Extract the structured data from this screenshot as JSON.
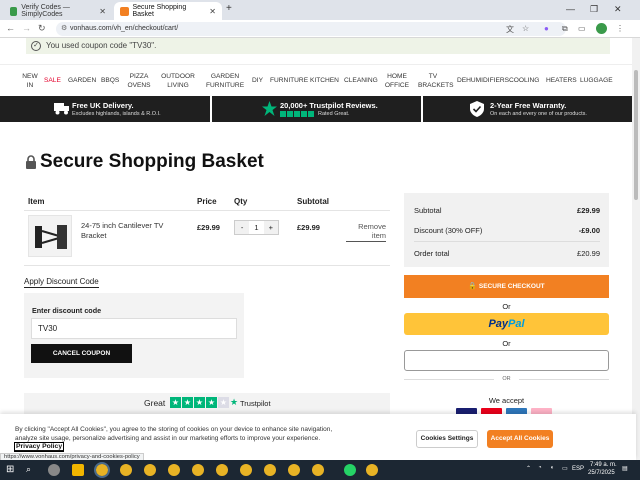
{
  "browser": {
    "tabs": [
      {
        "label": "Verify Codes — SimplyCodes",
        "active": false
      },
      {
        "label": "Secure Shopping Basket",
        "active": true
      }
    ],
    "new_tab": "+",
    "url": "vonhaus.com/vh_en/checkout/cart/",
    "status_url": "https://www.vonhaus.com/privacy-and-cookies-policy"
  },
  "notice": {
    "text": "You used coupon code \"TV30\"."
  },
  "menu": {
    "items": [
      "NEW IN",
      "SALE",
      "GARDEN",
      "BBQS",
      "PIZZA OVENS",
      "OUTDOOR LIVING",
      "GARDEN FURNITURE",
      "DIY",
      "FURNITURE",
      "KITCHEN",
      "CLEANING",
      "HOME OFFICE",
      "TV BRACKETS",
      "DEHUMIDIFIERS",
      "COOLING",
      "HEATERS",
      "LUGGAGE"
    ]
  },
  "band": {
    "delivery_title": "Free UK Delivery.",
    "delivery_sub": "Excludes highlands, islands & R.O.I.",
    "trustpilot_title": "20,000+ Trustpilot Reviews.",
    "trustpilot_sub": "Rated Great.",
    "warranty_title": "2-Year Free Warranty.",
    "warranty_sub": "On each and every one of our products."
  },
  "page": {
    "title": "Secure Shopping Basket"
  },
  "cart": {
    "headers": {
      "item": "Item",
      "price": "Price",
      "qty": "Qty",
      "subtotal": "Subtotal"
    },
    "item": {
      "name": "24-75 inch Cantilever TV Bracket",
      "price": "£29.99",
      "qty": "1",
      "subtotal": "£29.99",
      "remove": "Remove item"
    },
    "minus": "-",
    "plus": "+"
  },
  "discount": {
    "link": "Apply Discount Code",
    "label": "Enter discount code",
    "value": "TV30",
    "cancel": "Cancel Coupon"
  },
  "trustpilot": {
    "great": "Great",
    "brand": "Trustpilot"
  },
  "summary": {
    "subtotal_label": "Subtotal",
    "subtotal_value": "£29.99",
    "discount_label": "Discount (30% OFF)",
    "discount_value": "-£9.00",
    "total_label": "Order total",
    "total_value": "£20.99",
    "checkout": "Secure Checkout",
    "or": "Or",
    "paypal_1": "Pay",
    "paypal_2": "Pal",
    "small_or": "OR",
    "we_accept": "We accept"
  },
  "cookie": {
    "text": "By clicking \"Accept All Cookies\", you agree to the storing of cookies on your device to enhance site navigation, analyze site usage, personalize advertising and assist in our marketing efforts to improve your experience.",
    "privacy": "Privacy Policy",
    "settings": "Cookies Settings",
    "accept": "Accept All Cookies"
  },
  "taskbar": {
    "lang": "ESP",
    "time": "7:49 a. m.",
    "date": "25/7/2025"
  },
  "colors": {
    "accent": "#f28022",
    "paypal": "#ffc439",
    "trust_green": "#00b67a",
    "sale_red": "#e4002b"
  }
}
